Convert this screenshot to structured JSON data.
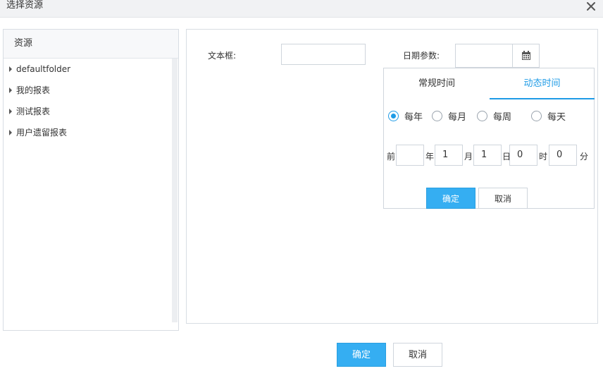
{
  "dialog": {
    "title": "选择资源",
    "close_icon": "close-icon"
  },
  "resources": {
    "header": "资源",
    "items": [
      {
        "label": "defaultfolder"
      },
      {
        "label": "我的报表"
      },
      {
        "label": "测试报表"
      },
      {
        "label": "用户遗留报表"
      }
    ]
  },
  "form": {
    "text_label": "文本框:",
    "text_value": "",
    "date_label": "日期参数:",
    "date_value": "",
    "date_icon": "calendar-icon"
  },
  "picker": {
    "tabs": [
      {
        "label": "常规时间",
        "active": false
      },
      {
        "label": "动态时间",
        "active": true
      }
    ],
    "radios": [
      {
        "label": "每年",
        "checked": true
      },
      {
        "label": "每月",
        "checked": false
      },
      {
        "label": "每周",
        "checked": false
      },
      {
        "label": "每天",
        "checked": false
      }
    ],
    "prefix": "前",
    "fields": [
      {
        "value": "",
        "unit": "年"
      },
      {
        "value": "1",
        "unit": "月"
      },
      {
        "value": "1",
        "unit": "日"
      },
      {
        "value": "0",
        "unit": "时"
      },
      {
        "value": "0",
        "unit": "分"
      }
    ],
    "ok_label": "确定",
    "cancel_label": "取消"
  },
  "footer": {
    "ok_label": "确定",
    "cancel_label": "取消"
  },
  "colors": {
    "accent": "#35aef2",
    "tab_active": "#1e9be6",
    "border": "#cfd5dc"
  }
}
